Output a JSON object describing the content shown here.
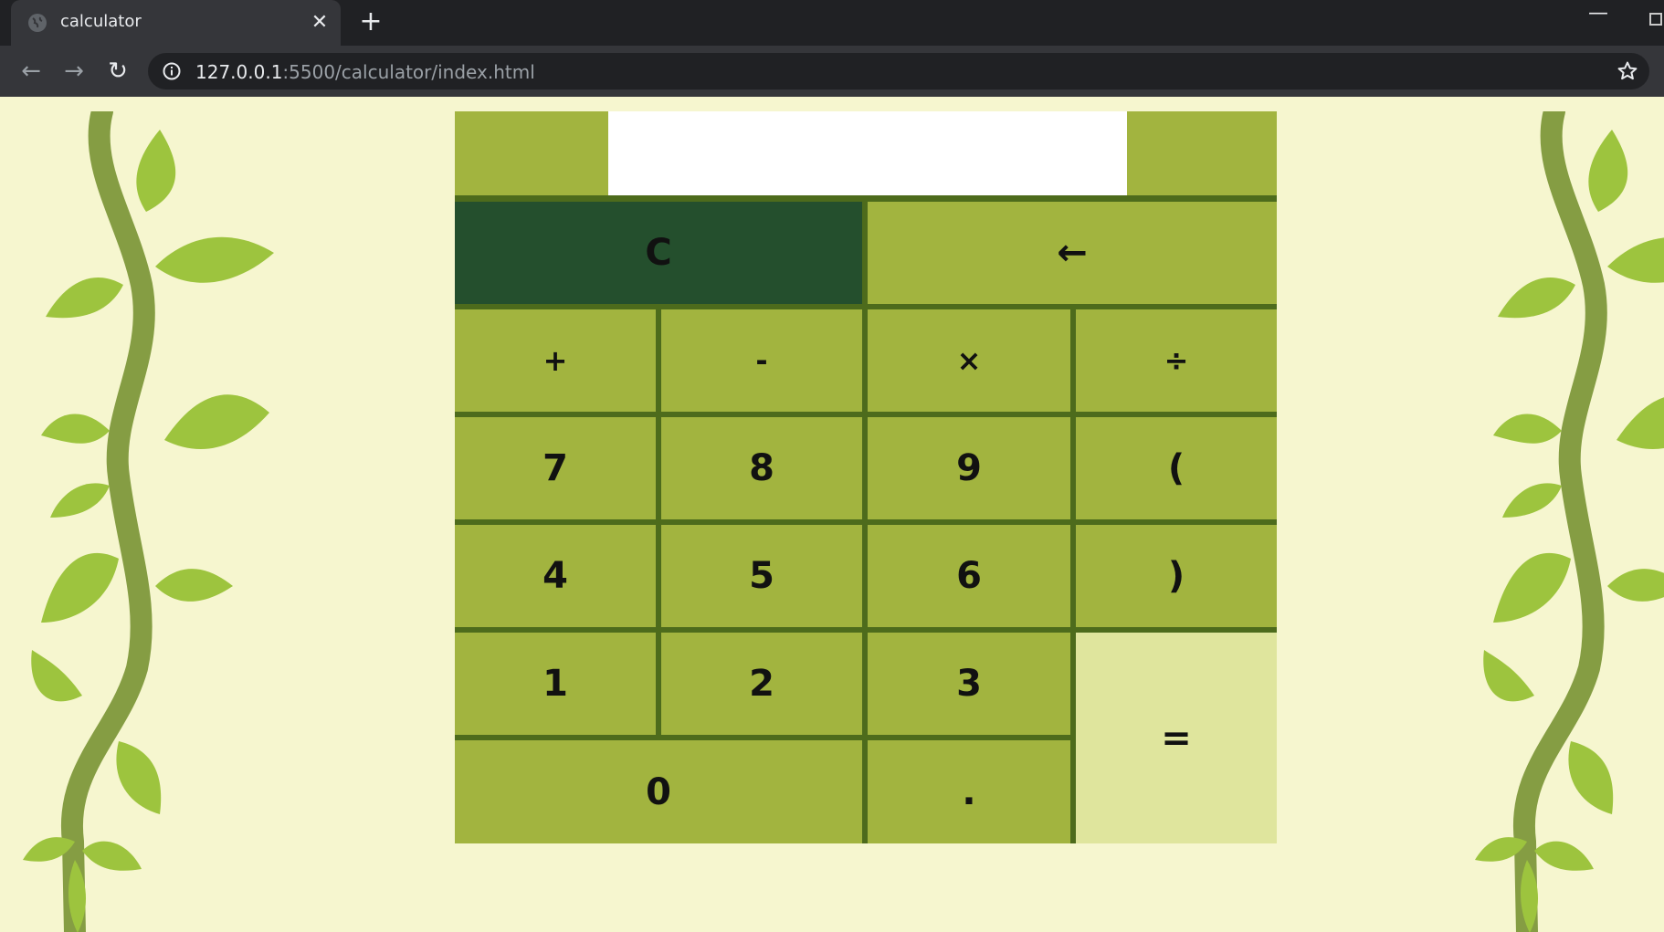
{
  "browser": {
    "tab_title": "calculator",
    "tab_close": "✕",
    "new_tab": "+",
    "window_minimize": "—",
    "nav_back": "←",
    "nav_forward": "→",
    "nav_reload": "↻",
    "url_host": "127.0.0.1",
    "url_rest": ":5500/calculator/index.html"
  },
  "calculator": {
    "display_value": "",
    "keys": {
      "clear": "C",
      "backspace": "←",
      "plus": "+",
      "minus": "-",
      "multiply": "×",
      "divide": "÷",
      "seven": "7",
      "eight": "8",
      "nine": "9",
      "open_paren": "(",
      "four": "4",
      "five": "5",
      "six": "6",
      "close_paren": ")",
      "one": "1",
      "two": "2",
      "three": "3",
      "equals": "=",
      "zero": "0",
      "decimal": "."
    }
  },
  "colors": {
    "page_background": "#f6f6cf",
    "key_green": "#a2b43f",
    "clear_key": "#244f2d",
    "equals_key": "#dfe59d",
    "grid_lines": "#4d6b1c",
    "vine_stem": "#859d43",
    "leaf": "#9dc43e"
  }
}
